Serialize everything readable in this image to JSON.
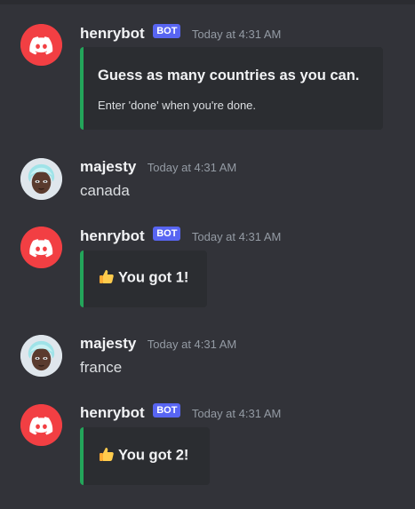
{
  "messages": [
    {
      "author": "henrybot",
      "badge": "BOT",
      "timestamp": "Today at 4:31 AM",
      "embed_title": "Guess as many countries as you can.",
      "embed_desc": "Enter 'done' when you're done."
    },
    {
      "author": "majesty",
      "timestamp": "Today at 4:31 AM",
      "text": "canada"
    },
    {
      "author": "henrybot",
      "badge": "BOT",
      "timestamp": "Today at 4:31 AM",
      "embed_icon": "thumbs-up-icon",
      "embed_title": "You got 1!"
    },
    {
      "author": "majesty",
      "timestamp": "Today at 4:31 AM",
      "text": "france"
    },
    {
      "author": "henrybot",
      "badge": "BOT",
      "timestamp": "Today at 4:31 AM",
      "embed_icon": "thumbs-up-icon",
      "embed_title": "You got 2!"
    }
  ],
  "colors": {
    "background": "#323339",
    "embed_background": "#2b2d31",
    "embed_accent": "#23a55a",
    "bot_badge": "#5865f2",
    "bot_avatar": "#f23f43"
  }
}
